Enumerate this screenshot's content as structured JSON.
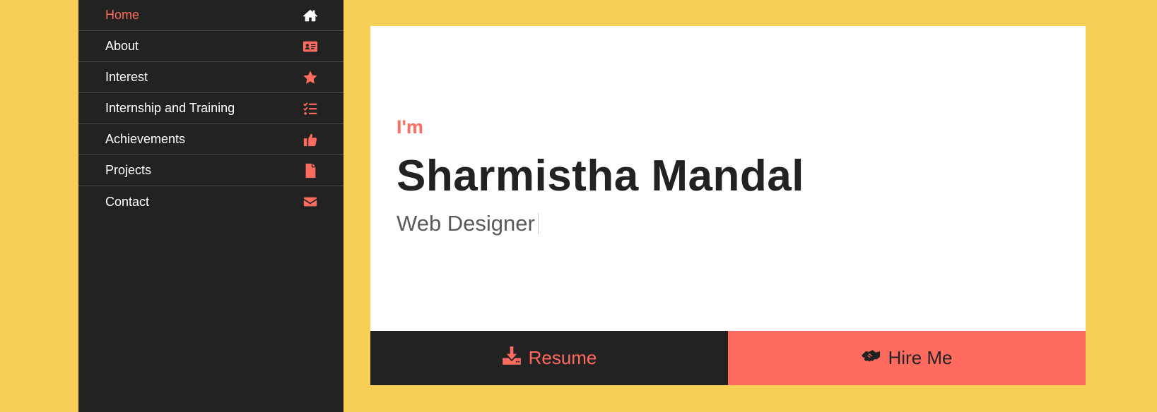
{
  "nav": {
    "items": [
      {
        "label": "Home",
        "icon": "home-icon",
        "active": true
      },
      {
        "label": "About",
        "icon": "id-card-icon"
      },
      {
        "label": "Interest",
        "icon": "star-icon"
      },
      {
        "label": "Internship and Training",
        "icon": "tasks-icon"
      },
      {
        "label": "Achievements",
        "icon": "thumbs-up-icon"
      },
      {
        "label": "Projects",
        "icon": "file-icon"
      },
      {
        "label": "Contact",
        "icon": "envelope-icon"
      }
    ]
  },
  "hero": {
    "intro": "I'm",
    "name": "Sharmistha Mandal",
    "role": "Web Designer"
  },
  "buttons": {
    "resume_label": "Resume",
    "hire_label": "Hire Me"
  },
  "colors": {
    "background": "#f7cf54",
    "sidebar": "#222222",
    "accent": "#ff6b5e",
    "card": "#ffffff"
  }
}
